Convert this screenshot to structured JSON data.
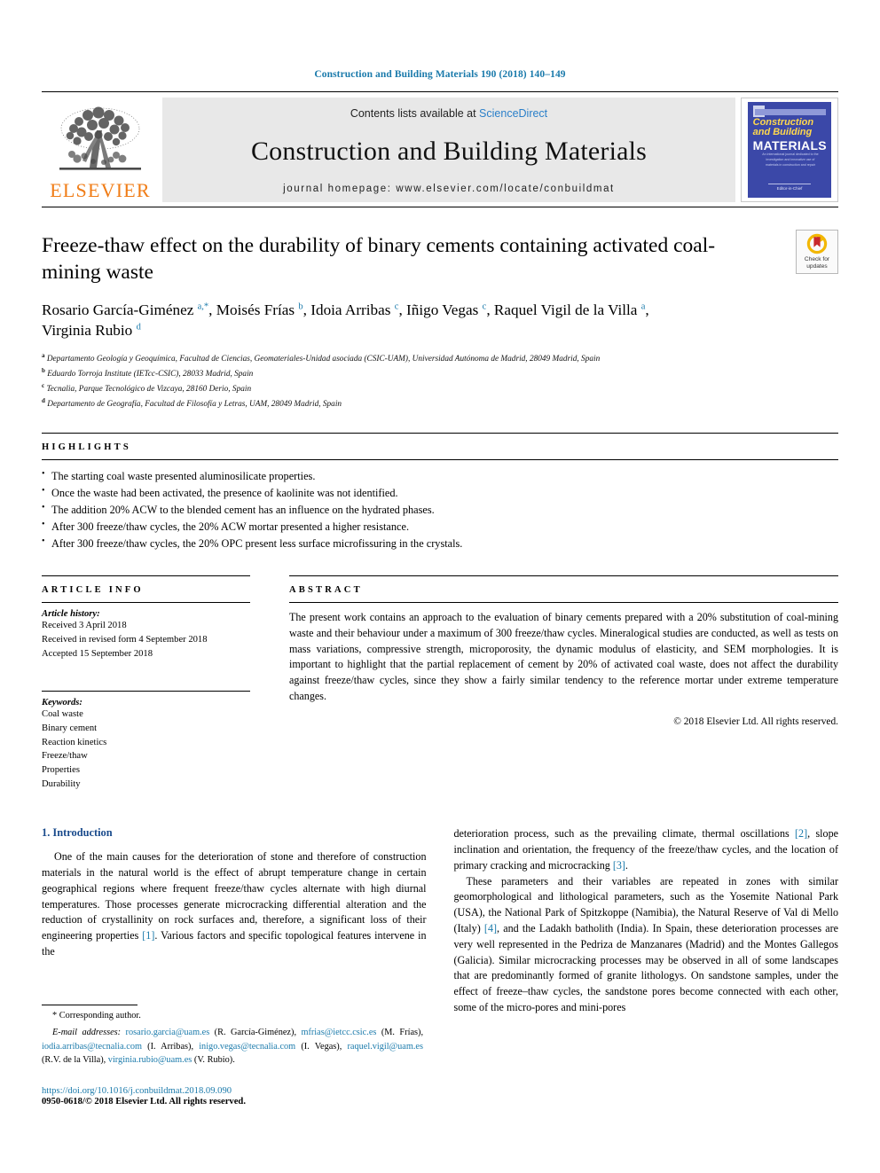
{
  "running_head": "Construction and Building Materials 190 (2018) 140–149",
  "masthead": {
    "publisher_name": "ELSEVIER",
    "contents_prefix": "Contents lists available at ",
    "contents_link": "ScienceDirect",
    "journal_title": "Construction and Building Materials",
    "homepage": "journal homepage: www.elsevier.com/locate/conbuildmat",
    "cover": {
      "line1": "Construction",
      "line2": "and Building",
      "line3": "MATERIALS",
      "blurb": "An international journal dedicated to the investigation and innovative use of materials in construction and repair",
      "footer": "Editor-in-Chief"
    }
  },
  "article": {
    "title": "Freeze-thaw effect on the durability of binary cements containing activated coal-mining waste",
    "crossmark_line1": "Check for",
    "crossmark_line2": "updates",
    "authors_line1": "Rosario García-Giménez <sup>a,*</sup>, Moisés Frías <sup>b</sup>, Idoia Arribas <sup>c</sup>, Iñigo Vegas <sup>c</sup>, Raquel Vigil de la Villa <sup>a</sup>,",
    "authors_line2": "Virginia Rubio <sup>d</sup>",
    "affiliations": [
      {
        "mark": "a",
        "text": "Departamento Geología y Geoquímica, Facultad de Ciencias, Geomateriales-Unidad asociada (CSIC-UAM), Universidad Autónoma de Madrid, 28049 Madrid, Spain"
      },
      {
        "mark": "b",
        "text": "Eduardo Torroja Institute (IETcc-CSIC), 28033 Madrid, Spain"
      },
      {
        "mark": "c",
        "text": "Tecnalia, Parque Tecnológico de Vizcaya, 28160 Derio, Spain"
      },
      {
        "mark": "d",
        "text": "Departamento de Geografía, Facultad de Filosofía y Letras, UAM, 28049 Madrid, Spain"
      }
    ]
  },
  "highlights": {
    "label": "HIGHLIGHTS",
    "items": [
      "The starting coal waste presented aluminosilicate properties.",
      "Once the waste had been activated, the presence of kaolinite was not identified.",
      "The addition 20% ACW to the blended cement has an influence on the hydrated phases.",
      "After 300 freeze/thaw cycles, the 20% ACW mortar presented a higher resistance.",
      "After 300 freeze/thaw cycles, the 20% OPC present less surface microfissuring in the crystals."
    ]
  },
  "article_info": {
    "label": "ARTICLE INFO",
    "history_title": "Article history:",
    "history": [
      "Received 3 April 2018",
      "Received in revised form 4 September 2018",
      "Accepted 15 September 2018"
    ],
    "keywords_title": "Keywords:",
    "keywords": [
      "Coal waste",
      "Binary cement",
      "Reaction kinetics",
      "Freeze/thaw",
      "Properties",
      "Durability"
    ]
  },
  "abstract": {
    "label": "ABSTRACT",
    "text": "The present work contains an approach to the evaluation of binary cements prepared with a 20% substitution of coal-mining waste and their behaviour under a maximum of 300 freeze/thaw cycles. Mineralogical studies are conducted, as well as tests on mass variations, compressive strength, microporosity, the dynamic modulus of elasticity, and SEM morphologies. It is important to highlight that the partial replacement of cement by 20% of activated coal waste, does not affect the durability against freeze/thaw cycles, since they show a fairly similar tendency to the reference mortar under extreme temperature changes.",
    "copyright": "© 2018 Elsevier Ltd. All rights reserved."
  },
  "body": {
    "section_heading": "1. Introduction",
    "left_paragraph_1": "One of the main causes for the deterioration of stone and therefore of construction materials in the natural world is the effect of abrupt temperature change in certain geographical regions where frequent freeze/thaw cycles alternate with high diurnal temperatures. Those processes generate microcracking differential alteration and the reduction of crystallinity on rock surfaces and, therefore, a significant loss of their engineering properties [1]. Various factors and specific topological features intervene in the",
    "right_paragraph_1": "deterioration process, such as the prevailing climate, thermal oscillations [2], slope inclination and orientation, the frequency of the freeze/thaw cycles, and the location of primary cracking and microcracking [3].",
    "right_paragraph_2": "These parameters and their variables are repeated in zones with similar geomorphological and lithological parameters, such as the Yosemite National Park (USA), the National Park of Spitzkoppe (Namibia), the Natural Reserve of Val di Mello (Italy) [4], and the Ladakh batholith (India). In Spain, these deterioration processes are very well represented in the Pedriza de Manzanares (Madrid) and the Montes Gallegos (Galicia). Similar microcracking processes may be observed in all of some landscapes that are predominantly formed of granite lithologys. On sandstone samples, under the effect of freeze–thaw cycles, the sandstone pores become connected with each other, some of the micro-pores and mini-pores",
    "refs": [
      "[1]",
      "[2]",
      "[3]",
      "[4]"
    ]
  },
  "footnotes": {
    "corresponding": "* Corresponding author.",
    "email_label": "E-mail addresses:",
    "emails": [
      {
        "address": "rosario.garcia@uam.es",
        "person": "(R. García-Giménez)"
      },
      {
        "address": "mfrias@ietcc.csic.es",
        "person": "(M. Frías)"
      },
      {
        "address": "iodia.arribas@tecnalia.com",
        "person": "(I. Arribas)"
      },
      {
        "address": "inigo.vegas@tecnalia.com",
        "person": "(I. Vegas)"
      },
      {
        "address": "raquel.vigil@uam.es",
        "person": "(R.V. de la Villa)"
      },
      {
        "address": "virginia.rubio@uam.es",
        "person": "(V. Rubio)"
      }
    ],
    "doi": "https://doi.org/10.1016/j.conbuildmat.2018.09.090",
    "issn": "0950-0618/© 2018 Elsevier Ltd. All rights reserved."
  },
  "colors": {
    "link": "#1a7aab",
    "heading": "#1a4b8c",
    "elsevier_orange": "#f07c16",
    "band_gray": "#e8e8e8",
    "cover_blue": "#3b48a8"
  }
}
